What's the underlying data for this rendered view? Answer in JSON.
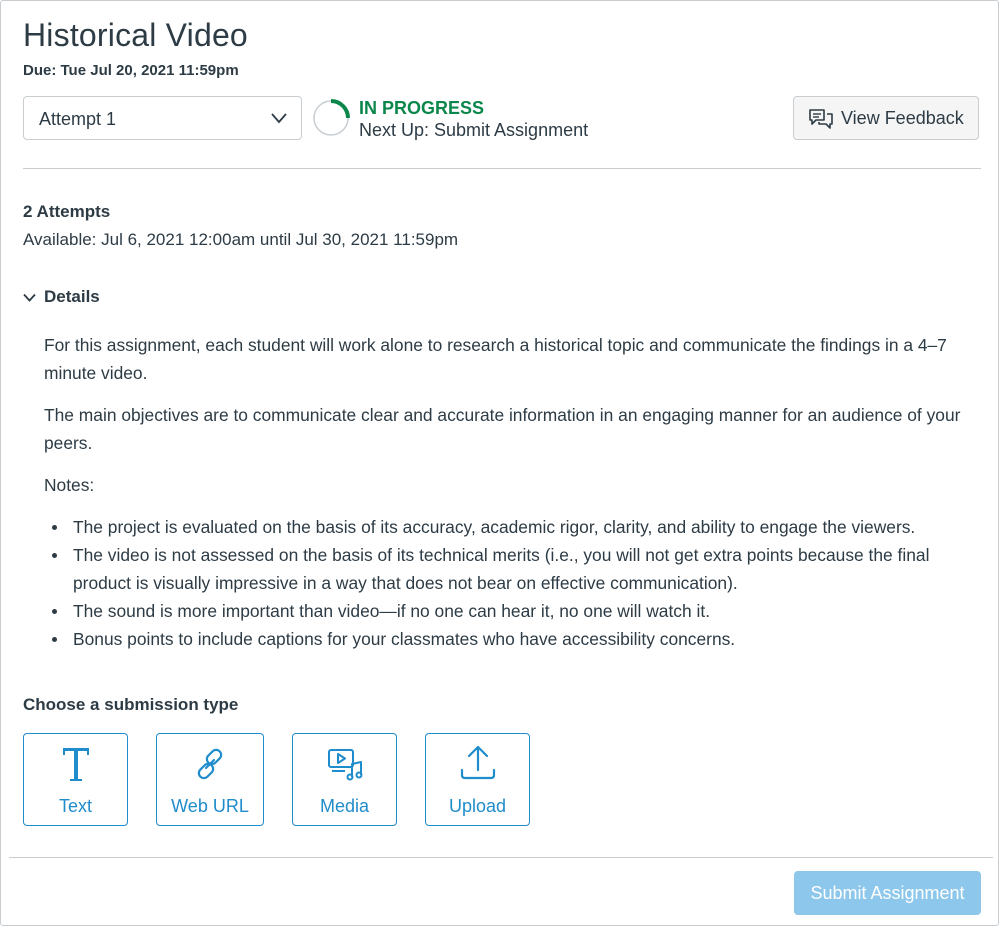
{
  "assignment": {
    "title": "Historical Video",
    "due": "Due: Tue Jul 20, 2021 11:59pm"
  },
  "attempt_select": {
    "selected": "Attempt 1",
    "icon": "chevron-down-icon"
  },
  "status": {
    "state": "IN PROGRESS",
    "next_up": "Next Up: Submit Assignment",
    "progress": 0.25,
    "color": "#0b874b"
  },
  "feedback_button": {
    "label": "View Feedback",
    "icon": "feedback-icon"
  },
  "info": {
    "attempts": "2 Attempts",
    "available": "Available: Jul 6, 2021 12:00am until Jul 30, 2021 11:59pm"
  },
  "details": {
    "label": "Details",
    "paragraphs": [
      "For this assignment, each student will work alone to research a historical topic and communicate the findings in a 4–7 minute video.",
      "The main objectives are to communicate clear and accurate information in an engaging manner for an audience of your peers.",
      "Notes:"
    ],
    "bullets": [
      "The project is evaluated on the basis of its accuracy, academic rigor, clarity, and ability to engage the viewers.",
      "The video is not assessed on the basis of its technical merits (i.e., you will not get extra points because the final product is visually impressive in a way that does not bear on effective communication).",
      "The sound is more important than video—if no one can hear it, no one will watch it.",
      "Bonus points to include captions for your classmates who have accessibility concerns."
    ]
  },
  "submission": {
    "heading": "Choose a submission type",
    "types": [
      {
        "label": "Text",
        "icon": "text-icon"
      },
      {
        "label": "Web URL",
        "icon": "link-icon"
      },
      {
        "label": "Media",
        "icon": "media-icon"
      },
      {
        "label": "Upload",
        "icon": "upload-icon"
      }
    ]
  },
  "footer": {
    "submit_label": "Submit Assignment"
  },
  "colors": {
    "accent": "#1f8ccb",
    "text": "#2d3b45",
    "border": "#c7cdd1",
    "submit_disabled": "#8dc7eb"
  }
}
